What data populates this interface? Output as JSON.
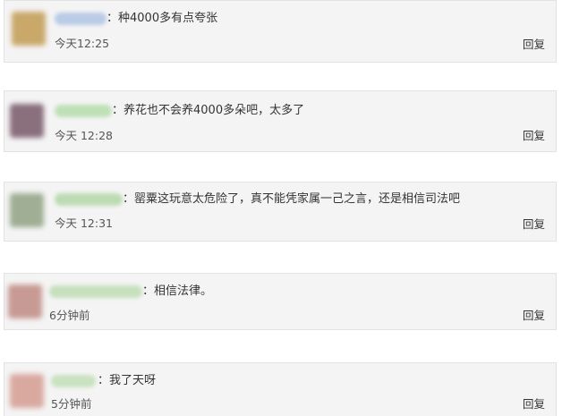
{
  "comments": [
    {
      "colon": "：",
      "text": "种4000多有点夸张",
      "time": "今天12:25",
      "reply": "回复",
      "avatar_color": "#c9a86a",
      "name_color": "#b9cbe6"
    },
    {
      "colon": "：",
      "text": "养花也不会养4000多朵吧，太多了",
      "time": "今天 12:28",
      "reply": "回复",
      "avatar_color": "#8a6f7d",
      "name_color": "#bfe0b7"
    },
    {
      "colon": "：",
      "text": "罂粟这玩意太危险了，真不能凭家属一己之言，还是相信司法吧",
      "time": "今天 12:31",
      "reply": "回复",
      "avatar_color": "#9fae94",
      "name_color": "#bcdcb3"
    },
    {
      "colon": "：",
      "text": "相信法律。",
      "time": "6分钟前",
      "reply": "回复",
      "avatar_color": "#c79a93",
      "name_color": "#c6e0bd"
    },
    {
      "colon": "：",
      "text": "我了天呀",
      "time": "5分钟前",
      "reply": "回复",
      "avatar_color": "#d9a9a0",
      "name_color": "#c9e2c0"
    }
  ]
}
